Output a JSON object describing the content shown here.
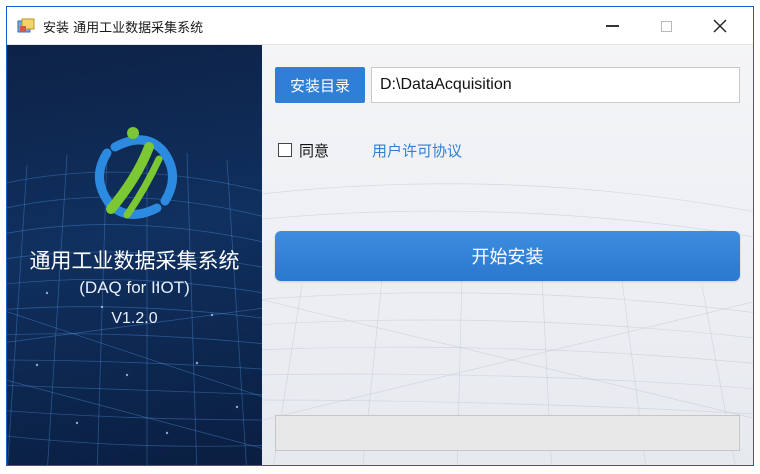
{
  "window": {
    "title": "安装 通用工业数据采集系统"
  },
  "product": {
    "name": "通用工业数据采集系统",
    "subtitle": "(DAQ for IIOT)",
    "version": "V1.2.0"
  },
  "install_dir": {
    "label": "安装目录",
    "value": "D:\\DataAcquisition"
  },
  "agreement": {
    "checked": false,
    "label": "同意",
    "link_text": "用户许可协议"
  },
  "install_button": {
    "label": "开始安装"
  },
  "progress": {
    "percent": 0
  },
  "colors": {
    "accent": "#2f7fd6",
    "left_panel": "#10305f",
    "logo_blue": "#2c8be0",
    "logo_green": "#7cc832"
  },
  "icons": {
    "app": "installer-icon",
    "minimize": "minimize-icon",
    "maximize": "maximize-icon",
    "close": "close-icon",
    "logo": "daq-logo-icon"
  }
}
